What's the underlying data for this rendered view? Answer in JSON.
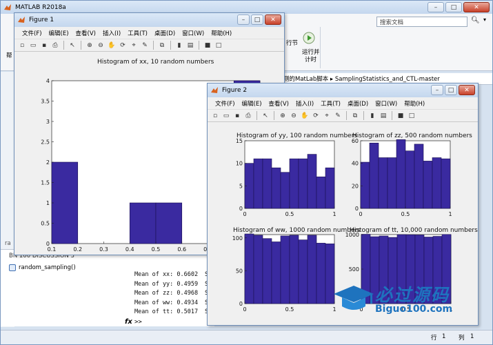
{
  "app": {
    "title": "MATLAB R2018a",
    "search_placeholder": "搜索文档",
    "ribbon_btn_partial": "行节",
    "run_time_label_1": "运行并",
    "run_time_label_2": "计时",
    "path_text": "测的MatLab脚本 ▸ SamplingStatistics_and_CTL-master",
    "left_partial_1": "帮",
    "left_partial_2": "ra",
    "left_partial_3": "BN 100 DISCUSSION 3",
    "file_item": "random_sampling()",
    "fx": "fx",
    "prompt": ">>",
    "status_row_label": "行",
    "status_row": "1",
    "status_col_label": "列",
    "status_col": "1",
    "console_lines": [
      "Mean of xx: 0.6602",
      "Mean of yy: 0.4959",
      "Mean of zz: 0.4968",
      "Mean of ww: 0.4934",
      "Mean of tt: 0.5017"
    ],
    "console_trailing": "S"
  },
  "menus": [
    "文件(F)",
    "编辑(E)",
    "查看(V)",
    "插入(I)",
    "工具(T)",
    "桌面(D)",
    "窗口(W)",
    "帮助(H)"
  ],
  "figure1": {
    "title": "Figure 1"
  },
  "figure2": {
    "title": "Figure 2"
  },
  "watermark": {
    "text1": "必过源码",
    "text2": "Biguo100.com"
  },
  "chart_data": [
    {
      "type": "bar",
      "title": "Histogram of xx, 10 random numbers",
      "bin_edges": [
        0.15,
        0.25,
        0.35,
        0.45,
        0.55,
        0.65,
        0.75,
        0.85
      ],
      "values": [
        2,
        0,
        0,
        1,
        1,
        0,
        2,
        4
      ],
      "xlim": [
        0.1,
        0.9
      ],
      "ylim": [
        0,
        4
      ],
      "xticks": [
        "0.1",
        "0.2",
        "0.3",
        "0.4",
        "0.5",
        "0.6",
        "0.7"
      ],
      "yticks": [
        "0",
        "0.5",
        "1",
        "1.5",
        "2",
        "2.5",
        "3",
        "3.5",
        "4"
      ]
    },
    {
      "type": "bar",
      "title": "Histogram of yy, 100 random numbers",
      "values": [
        10,
        11,
        11,
        9,
        8,
        11,
        11,
        12,
        7,
        9
      ],
      "xlim": [
        0,
        1
      ],
      "ylim": [
        0,
        15
      ],
      "xticks": [
        "0",
        "0.5",
        "1"
      ],
      "yticks": [
        "0",
        "5",
        "10",
        "15"
      ]
    },
    {
      "type": "bar",
      "title": "Histogram of zz, 500 random numbers",
      "values": [
        41,
        58,
        45,
        45,
        61,
        51,
        57,
        42,
        45,
        44
      ],
      "xlim": [
        0,
        1
      ],
      "ylim": [
        0,
        60
      ],
      "xticks": [
        "0",
        "0.5",
        "1"
      ],
      "yticks": [
        "0",
        "20",
        "40",
        "60"
      ]
    },
    {
      "type": "bar",
      "title": "Histogram of ww, 1000 random numbers",
      "values": [
        106,
        104,
        99,
        94,
        103,
        104,
        97,
        104,
        92,
        91
      ],
      "xlim": [
        0,
        1
      ],
      "ylim": [
        0,
        105
      ],
      "xticks": [
        "0",
        "0.5",
        "1"
      ],
      "yticks": [
        "0",
        "50",
        "100"
      ]
    },
    {
      "type": "bar",
      "title": "Histogram of tt, 10,000 random numbers",
      "values": [
        1005,
        970,
        980,
        960,
        1000,
        998,
        995,
        965,
        975,
        1002
      ],
      "xlim": [
        0,
        1
      ],
      "ylim": [
        0,
        1000
      ],
      "xticks": [
        "0",
        "0.5",
        "1"
      ],
      "yticks": [
        "0",
        "500",
        "1000"
      ]
    }
  ],
  "colors": {
    "bar": "#3a2aa0",
    "bar_edge": "#1a1050",
    "accent": "#1e73be"
  }
}
